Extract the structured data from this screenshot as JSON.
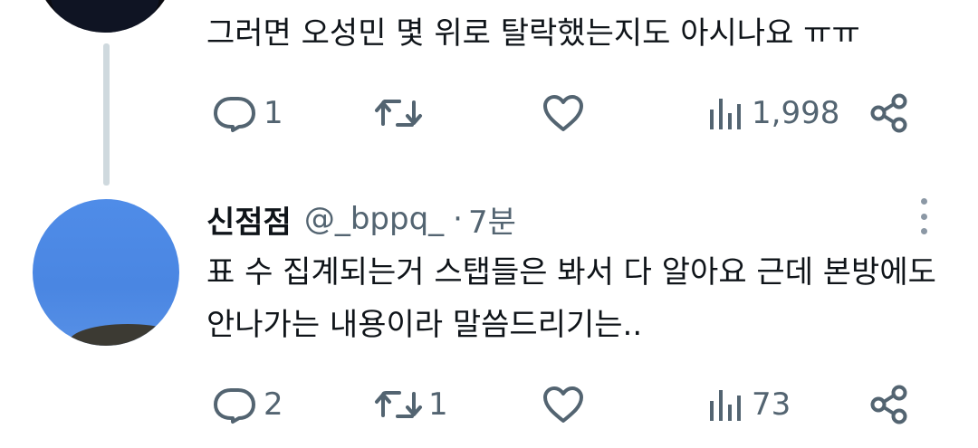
{
  "tweets": [
    {
      "text_lines": [
        "그러면 오성민 몇 위로 탈락했는지도 아시나요 ㅠㅠ"
      ],
      "replies": "1",
      "retweets": "",
      "likes": "",
      "views": "1,998"
    },
    {
      "name": "신점점",
      "handle": "@_bppq_",
      "separator": "·",
      "time": "7분",
      "text_lines": [
        "표 수 집계되는거 스탭들은 봐서 다 알아요 근데 본방에도",
        "안나가는 내용이라 말씀드리기는.."
      ],
      "replies": "2",
      "retweets": "1",
      "likes": "",
      "views": "73"
    }
  ],
  "icons": {
    "reply": "reply-bubble-icon",
    "retweet": "retweet-icon",
    "like": "heart-icon",
    "views": "views-bar-chart-icon",
    "share": "share-icon",
    "more": "more-vertical-icon"
  },
  "colors": {
    "text": "#0f1419",
    "muted": "#536471",
    "thread_line": "#cfd9de"
  }
}
